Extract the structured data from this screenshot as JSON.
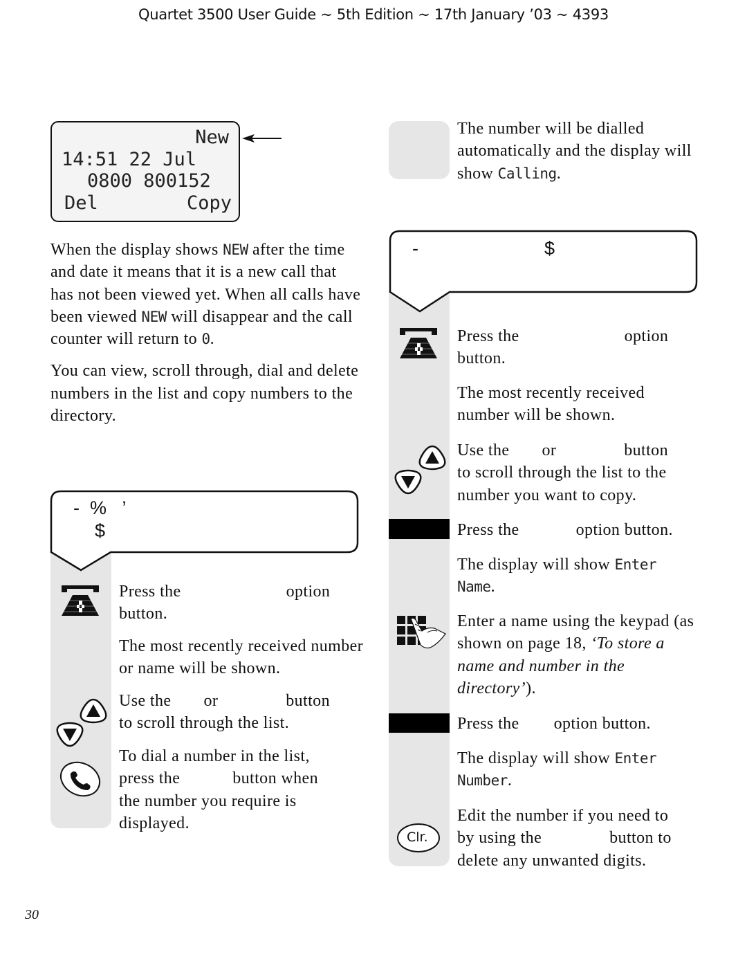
{
  "header": {
    "title": "Quartet 3500 User Guide ~ 5th Edition ~ 17th January ’03 ~ 4393"
  },
  "display": {
    "row1": "New",
    "row2": "14:51 22 Jul",
    "row3": "0800 800152",
    "softkey_left": "Del",
    "softkey_right": "Copy",
    "arrow_icon": "arrow-left-icon"
  },
  "left_intro": {
    "p1_a": "When the display shows ",
    "p1_lcd1": "NEW",
    "p1_b": " after the time and date it means that it is a new call that has not been viewed yet. When all calls have been viewed ",
    "p1_lcd2": "NEW",
    "p1_c": " will disappear and the call counter will return to ",
    "p1_lcd3": "0",
    "p1_d": ".",
    "p2": "You can view, scroll through, dial and delete numbers in the list and copy numbers to the directory."
  },
  "left_bubble": {
    "line1": "-  %   ’",
    "line2": "$"
  },
  "left_steps": [
    {
      "icon": "calls-list-phone-icon",
      "text_a": "Press the",
      "text_b": "option",
      "text_c": "button."
    },
    {
      "text": "The most recently received number or name will be shown."
    },
    {
      "icon": "up-down-scroll-icon",
      "text_a": "Use the",
      "text_b": "or",
      "text_c": "button",
      "text_d": "to scroll through the list."
    },
    {
      "icon": "talk-handset-icon",
      "line1": "To dial a number in the list,",
      "line2_a": "press the",
      "line2_b": "button when",
      "line3": "the number you require is",
      "line4": "displayed."
    }
  ],
  "right_top": {
    "text_a": "The number will be dialled automatically and the display will show ",
    "lcd": "Calling",
    "text_b": "."
  },
  "right_bubble": {
    "line1_a": "-",
    "line1_b": "$"
  },
  "right_steps": [
    {
      "icon": "calls-list-phone-icon",
      "text_a": "Press the",
      "text_b": "option",
      "text_c": "button."
    },
    {
      "text": "The most recently received number will be shown."
    },
    {
      "icon": "up-down-scroll-icon",
      "text_a": "Use the",
      "text_b": "or",
      "text_c": "button",
      "text_d": "to scroll through the list to the number you want to copy."
    },
    {
      "icon": "softkey-bar-icon",
      "text_a": "Press the",
      "text_b": "option button."
    },
    {
      "text_a": "The display will show ",
      "lcd": "Enter Name",
      "text_b": "."
    },
    {
      "icon": "keypad-hand-icon",
      "text_a": "Enter a name using the keypad (as shown on page 18, ",
      "italic": "‘To store a name and number in the directory’",
      "text_b": ")."
    },
    {
      "icon": "softkey-bar-icon",
      "text_a": "Press the",
      "text_b": "option button."
    },
    {
      "text_a": "The display will show ",
      "lcd": "Enter Number",
      "text_b": "."
    },
    {
      "icon": "clear-button-icon",
      "clr_label": "Clr.",
      "line1": "Edit the number if you need to",
      "line2_a": "by using the",
      "line2_b": "button to",
      "line3": "delete any unwanted digits."
    }
  ],
  "footer": {
    "page_number": "30"
  }
}
